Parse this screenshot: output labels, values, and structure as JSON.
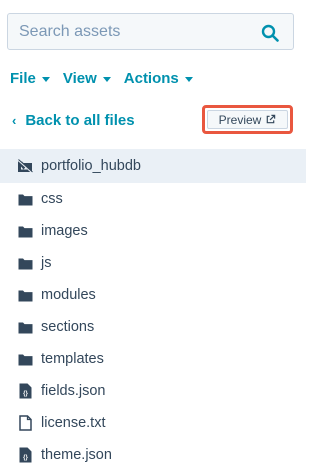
{
  "search": {
    "placeholder": "Search assets",
    "icon": "search-icon"
  },
  "menu": [
    {
      "label": "File"
    },
    {
      "label": "View"
    },
    {
      "label": "Actions"
    }
  ],
  "back": {
    "label": "Back to all files"
  },
  "preview": {
    "label": "Preview",
    "icon": "external-link-icon"
  },
  "files": [
    {
      "name": "portfolio_hubdb",
      "type": "theme",
      "icon": "theme-icon",
      "selected": true
    },
    {
      "name": "css",
      "type": "folder",
      "icon": "folder-icon"
    },
    {
      "name": "images",
      "type": "folder",
      "icon": "folder-icon"
    },
    {
      "name": "js",
      "type": "folder",
      "icon": "folder-icon"
    },
    {
      "name": "modules",
      "type": "folder",
      "icon": "folder-icon"
    },
    {
      "name": "sections",
      "type": "folder",
      "icon": "folder-icon"
    },
    {
      "name": "templates",
      "type": "folder",
      "icon": "folder-icon"
    },
    {
      "name": "fields.json",
      "type": "json",
      "icon": "json-file-icon"
    },
    {
      "name": "license.txt",
      "type": "txt",
      "icon": "text-file-icon"
    },
    {
      "name": "theme.json",
      "type": "json",
      "icon": "json-file-icon"
    }
  ],
  "colors": {
    "accent": "#0091ae",
    "text": "#33475b",
    "highlight_outline": "#e9573f",
    "selected_bg": "#eaf0f6"
  }
}
